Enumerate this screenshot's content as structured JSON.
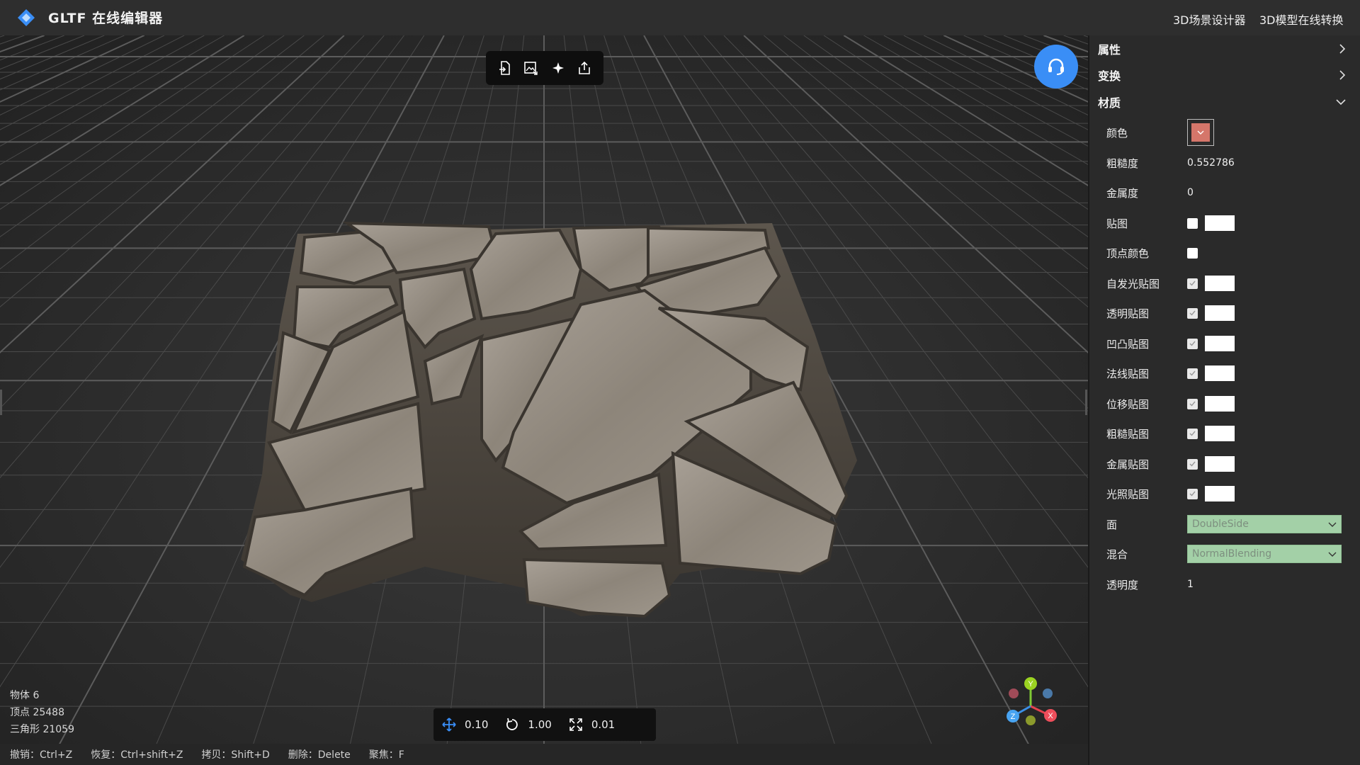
{
  "header": {
    "title": "GLTF 在线编辑器",
    "links": [
      "3D场景设计器",
      "3D模型在线转换"
    ],
    "brand_color": "#3a8ef6"
  },
  "toolbar": {
    "icons": [
      "import-icon",
      "image-export-icon",
      "light-icon",
      "share-icon"
    ]
  },
  "stats": {
    "objects": "物体 6",
    "vertices": "顶点 25488",
    "triangles": "三角形 21059"
  },
  "transform": {
    "move_value": "0.10",
    "rotate_value": "1.00",
    "scale_value": "0.01"
  },
  "shortcuts": [
    "撤销：Ctrl+Z",
    "恢复：Ctrl+shift+Z",
    "拷贝：Shift+D",
    "删除：Delete",
    "聚焦：F"
  ],
  "gizmo": {
    "y": "Y",
    "x": "X",
    "z": "Z"
  },
  "panel": {
    "sections": {
      "properties": "属性",
      "transform": "变换",
      "material": "材质"
    },
    "material": {
      "color_label": "颜色",
      "color_value": "#d5766a",
      "roughness_label": "粗糙度",
      "roughness_value": "0.552786",
      "metalness_label": "金属度",
      "metalness_value": "0",
      "map_label": "贴图",
      "vertex_color_label": "顶点颜色",
      "emissive_map_label": "自发光贴图",
      "alpha_map_label": "透明贴图",
      "bump_map_label": "凹凸贴图",
      "normal_map_label": "法线贴图",
      "displacement_map_label": "位移贴图",
      "roughness_map_label": "粗糙贴图",
      "metalness_map_label": "金属贴图",
      "light_map_label": "光照贴图",
      "side_label": "面",
      "side_value": "DoubleSide",
      "blending_label": "混合",
      "blending_value": "NormalBlending",
      "opacity_label": "透明度",
      "opacity_value": "1"
    }
  }
}
